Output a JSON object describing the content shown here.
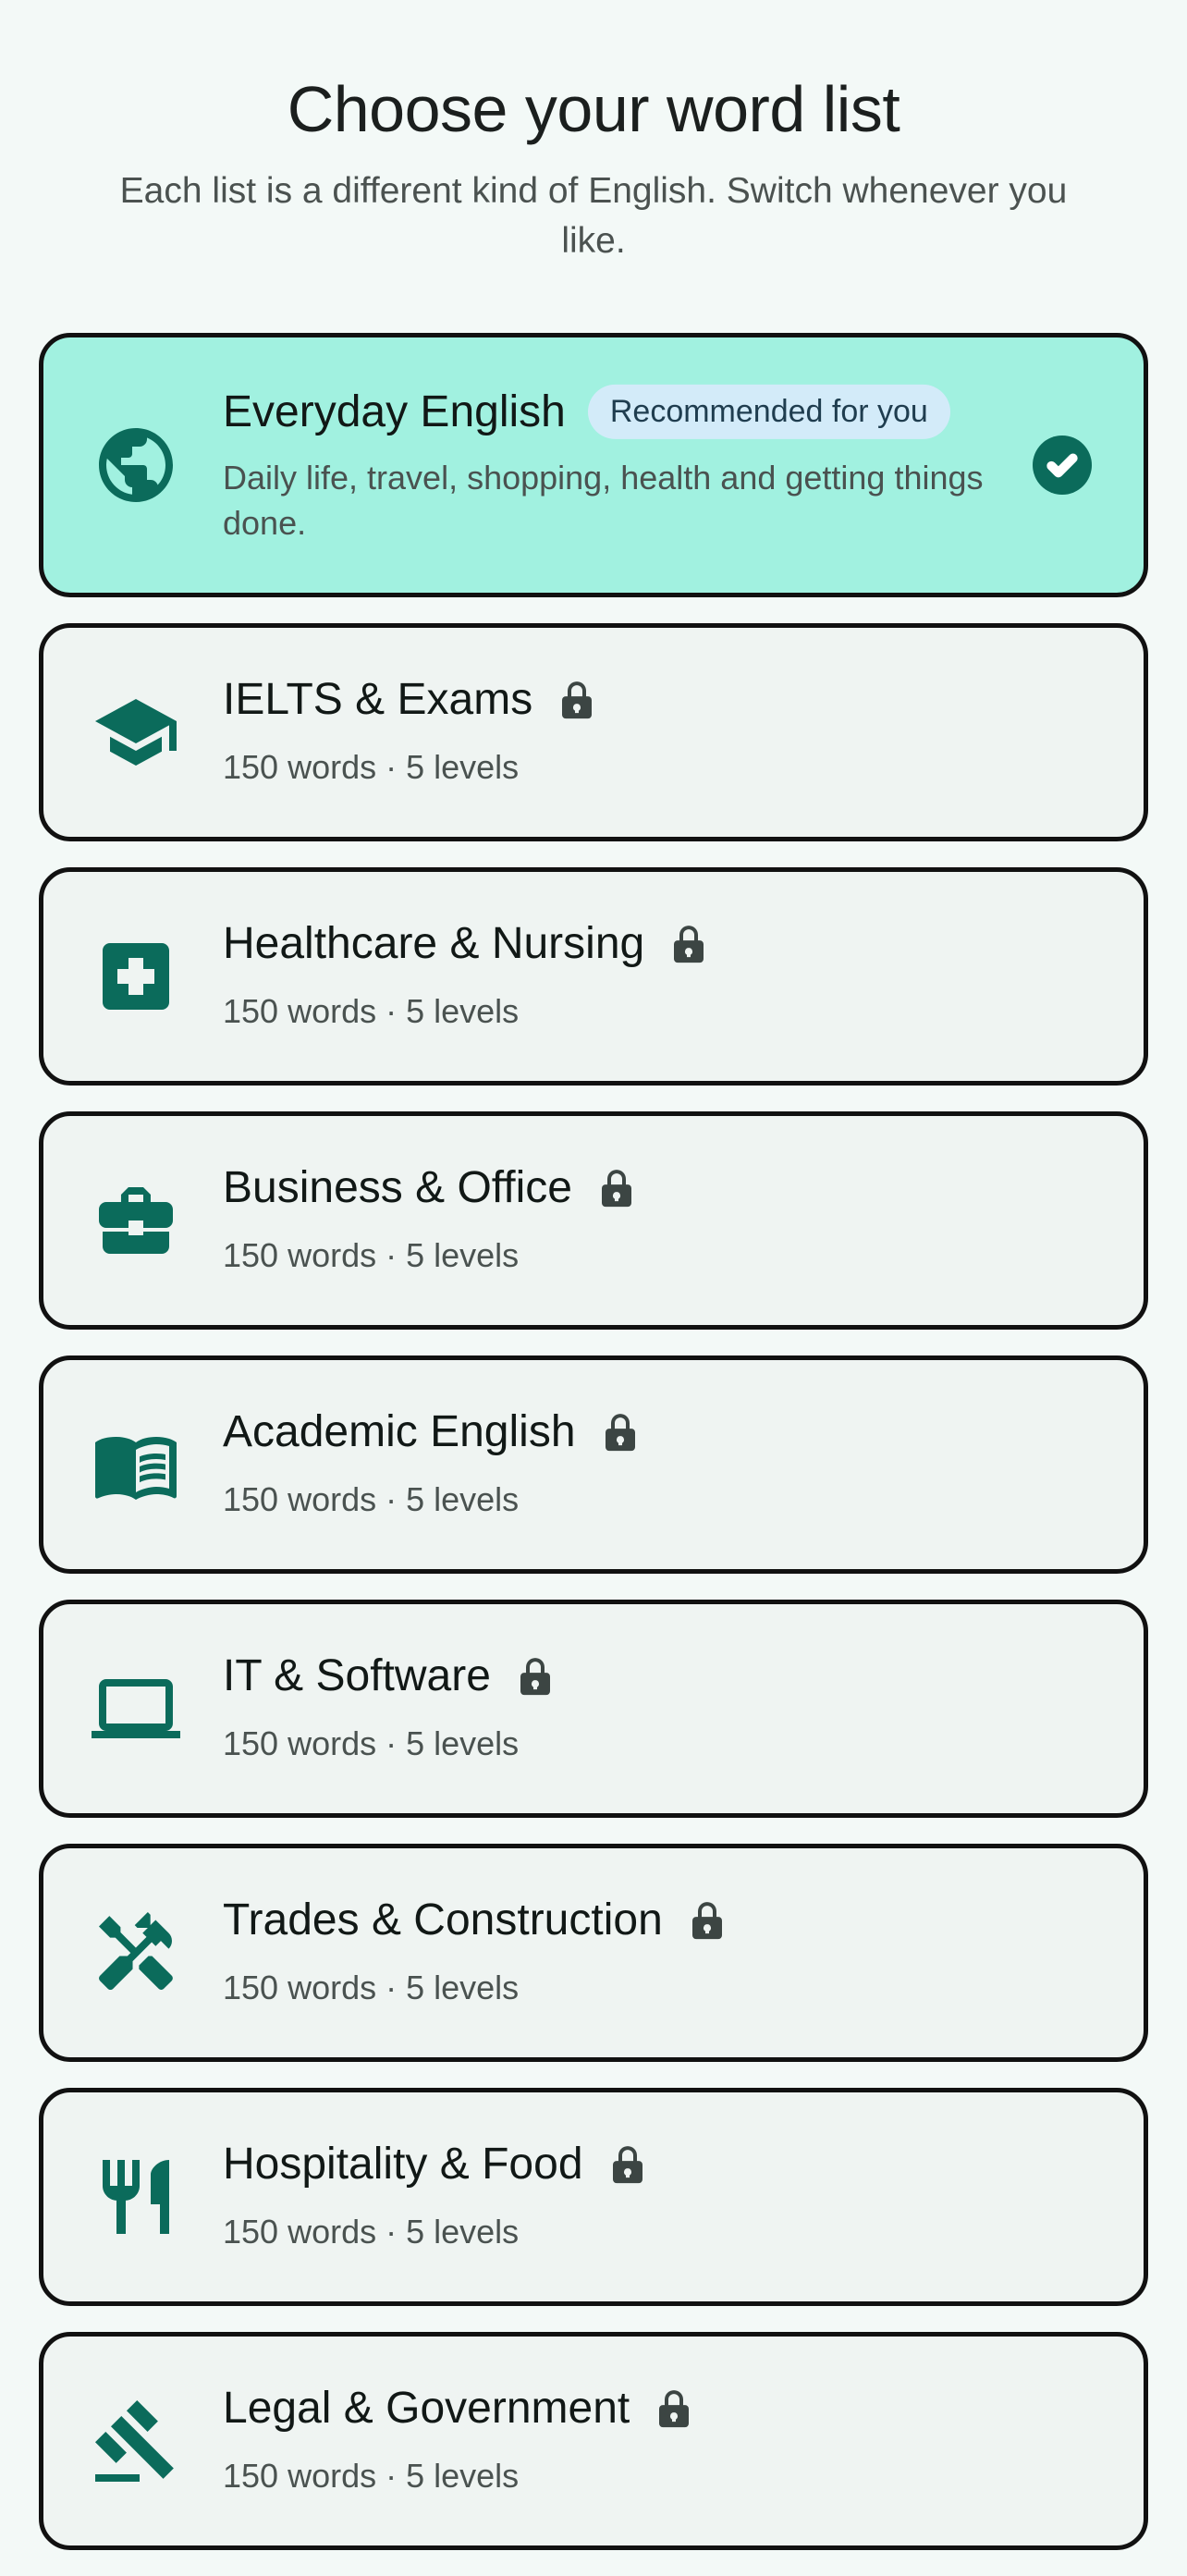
{
  "header": {
    "title": "Choose your word list",
    "subtitle": "Each list is a different kind of English. Switch whenever you like."
  },
  "colors": {
    "accent": "#0b6b5b",
    "selected_background": "#a1f1e0",
    "card_background": "#eff4f2",
    "badge_background": "#d3ebf9"
  },
  "lists": [
    {
      "title": "Everyday English",
      "icon": "globe-icon",
      "badge": "Recommended for you",
      "description": "Daily life, travel, shopping, health and getting things done.",
      "selected": true,
      "locked": false
    },
    {
      "title": "IELTS & Exams",
      "icon": "graduation-cap-icon",
      "meta": "150 words · 5 levels",
      "locked": true
    },
    {
      "title": "Healthcare & Nursing",
      "icon": "medical-cross-icon",
      "meta": "150 words · 5 levels",
      "locked": true
    },
    {
      "title": "Business & Office",
      "icon": "briefcase-icon",
      "meta": "150 words · 5 levels",
      "locked": true
    },
    {
      "title": "Academic English",
      "icon": "open-book-icon",
      "meta": "150 words · 5 levels",
      "locked": true
    },
    {
      "title": "IT & Software",
      "icon": "laptop-icon",
      "meta": "150 words · 5 levels",
      "locked": true
    },
    {
      "title": "Trades & Construction",
      "icon": "tools-icon",
      "meta": "150 words · 5 levels",
      "locked": true
    },
    {
      "title": "Hospitality & Food",
      "icon": "fork-knife-icon",
      "meta": "150 words · 5 levels",
      "locked": true
    },
    {
      "title": "Legal & Government",
      "icon": "gavel-icon",
      "meta": "150 words · 5 levels",
      "locked": true
    }
  ]
}
